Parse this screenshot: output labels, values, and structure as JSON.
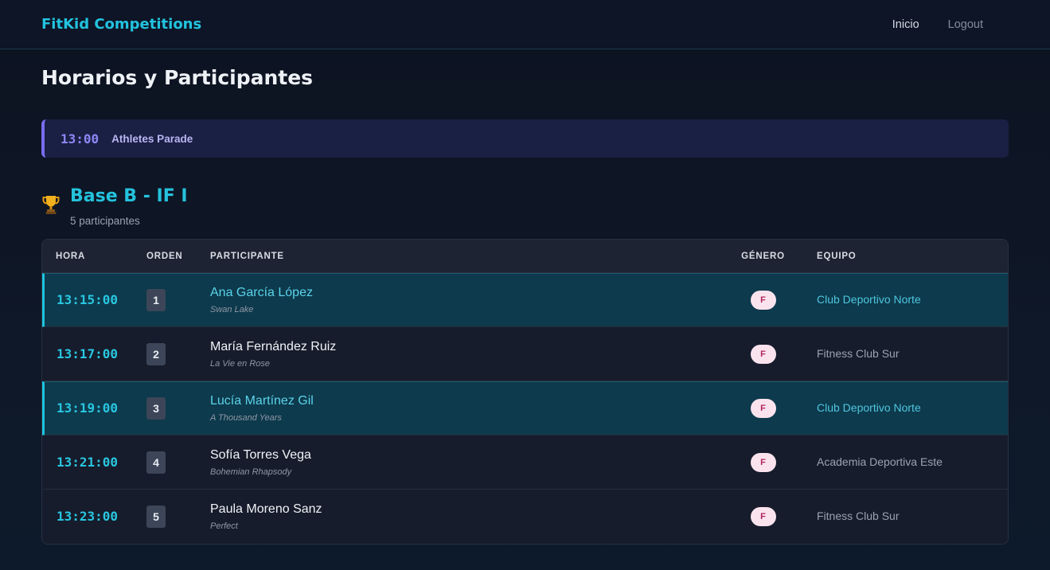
{
  "nav": {
    "brand": "FitKid Competitions",
    "links": [
      {
        "label": "Inicio"
      },
      {
        "label": "Logout"
      }
    ]
  },
  "page": {
    "title": "Horarios y Participantes"
  },
  "event": {
    "time": "13:00",
    "name": "Athletes Parade"
  },
  "category": {
    "icon": "trophy-icon",
    "title": "Base B - IF I",
    "subtitle": "5 participantes"
  },
  "table": {
    "headers": {
      "hora": "HORA",
      "orden": "ORDEN",
      "participante": "PARTICIPANTE",
      "genero": "GÉNERO",
      "equipo": "EQUIPO"
    },
    "rows": [
      {
        "hora": "13:15:00",
        "orden": "1",
        "nombre": "Ana García López",
        "musica": "Swan Lake",
        "genero": "F",
        "equipo": "Club Deportivo Norte",
        "highlighted": true
      },
      {
        "hora": "13:17:00",
        "orden": "2",
        "nombre": "María Fernández Ruiz",
        "musica": "La Vie en Rose",
        "genero": "F",
        "equipo": "Fitness Club Sur",
        "highlighted": false
      },
      {
        "hora": "13:19:00",
        "orden": "3",
        "nombre": "Lucía Martínez Gil",
        "musica": "A Thousand Years",
        "genero": "F",
        "equipo": "Club Deportivo Norte",
        "highlighted": true
      },
      {
        "hora": "13:21:00",
        "orden": "4",
        "nombre": "Sofía Torres Vega",
        "musica": "Bohemian Rhapsody",
        "genero": "F",
        "equipo": "Academia Deportiva Este",
        "highlighted": false
      },
      {
        "hora": "13:23:00",
        "orden": "5",
        "nombre": "Paula Moreno Sanz",
        "musica": "Perfect",
        "genero": "F",
        "equipo": "Fitness Club Sur",
        "highlighted": false
      }
    ]
  },
  "colors": {
    "accent": "#22c3df",
    "event_accent": "#7a6cf0",
    "highlight_row": "#0d3a4c",
    "gender_pill_bg": "#fbe3ee"
  }
}
